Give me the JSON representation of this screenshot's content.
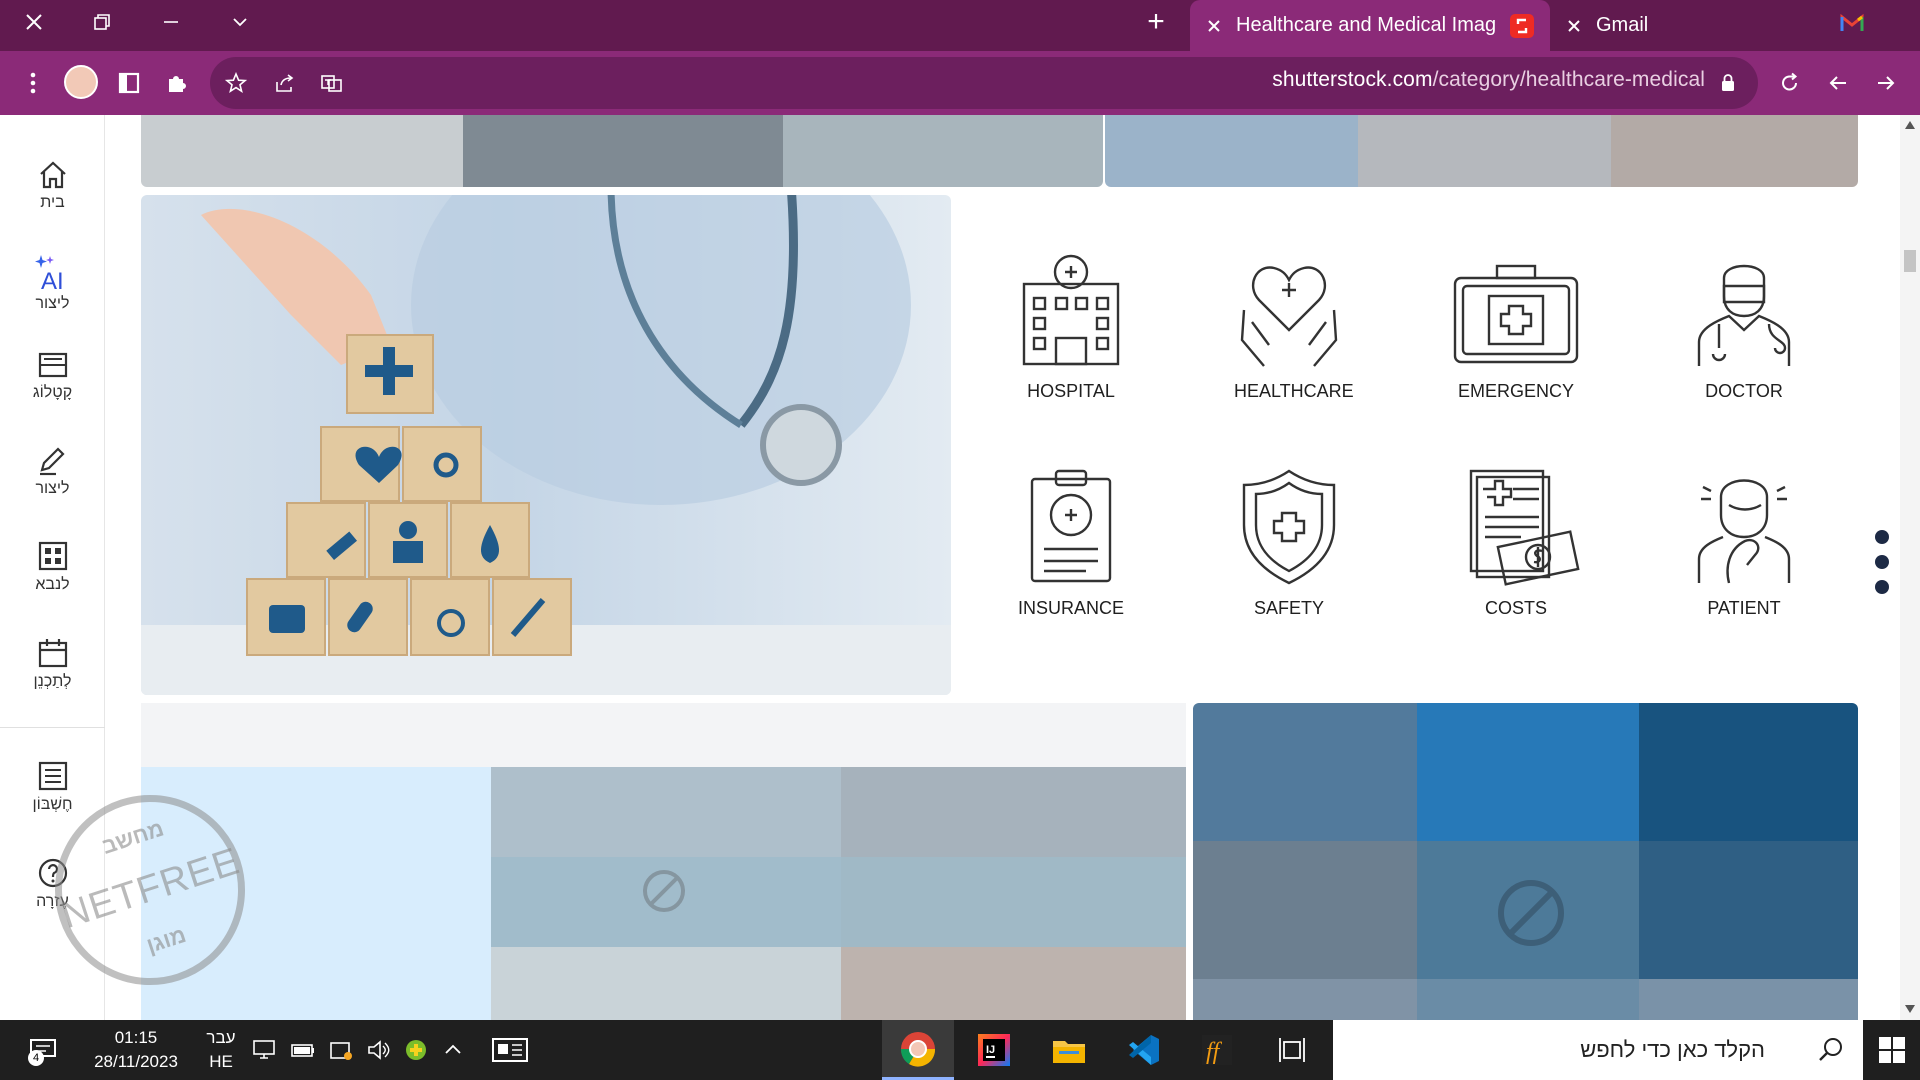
{
  "window": {
    "tabs": [
      {
        "title": "Healthcare and Medical Images,",
        "active": true
      },
      {
        "title": "Gmail",
        "active": false
      }
    ],
    "new_tab_label": "+"
  },
  "browser": {
    "url_host": "shutterstock.com",
    "url_path": "/category/healthcare-medical"
  },
  "sidebar": {
    "items": [
      {
        "label": "בית",
        "icon": "home-icon"
      },
      {
        "label": "ליצור",
        "icon": "ai-sparkle-icon"
      },
      {
        "label": "קָטָלוֹג",
        "icon": "catalog-tray-icon"
      },
      {
        "label": "ליצור",
        "icon": "edit-pencil-icon"
      },
      {
        "label": "לנבא",
        "icon": "grid-icon"
      },
      {
        "label": "לְתַכְנֵן",
        "icon": "calendar-icon"
      },
      {
        "label": "חֶשְׁבּוֹן",
        "icon": "list-icon"
      },
      {
        "label": "עֶזרָה",
        "icon": "help-circle-icon"
      }
    ]
  },
  "icon_grid": {
    "items": [
      {
        "label": "HOSPITAL",
        "icon": "hospital-icon"
      },
      {
        "label": "HEALTHCARE",
        "icon": "heart-hands-icon"
      },
      {
        "label": "EMERGENCY",
        "icon": "first-aid-kit-icon"
      },
      {
        "label": "DOCTOR",
        "icon": "doctor-icon"
      },
      {
        "label": "INSURANCE",
        "icon": "clipboard-icon"
      },
      {
        "label": "SAFETY",
        "icon": "shield-cross-icon"
      },
      {
        "label": "COSTS",
        "icon": "bill-money-icon"
      },
      {
        "label": "PATIENT",
        "icon": "patient-icon"
      }
    ]
  },
  "watermark": {
    "top": "מחשב",
    "middle": "NETFREE",
    "bottom": "מוגן"
  },
  "taskbar": {
    "search_placeholder": "הקלד כאן כדי לחפש",
    "time": "01:15",
    "date": "28/11/2023",
    "lang_top": "עבר",
    "lang_bottom": "HE",
    "notifications_count": "4"
  },
  "colors": {
    "titlebar": "#611a4f",
    "toolbar": "#8b2a78",
    "omnibox": "#6c1f5e"
  }
}
